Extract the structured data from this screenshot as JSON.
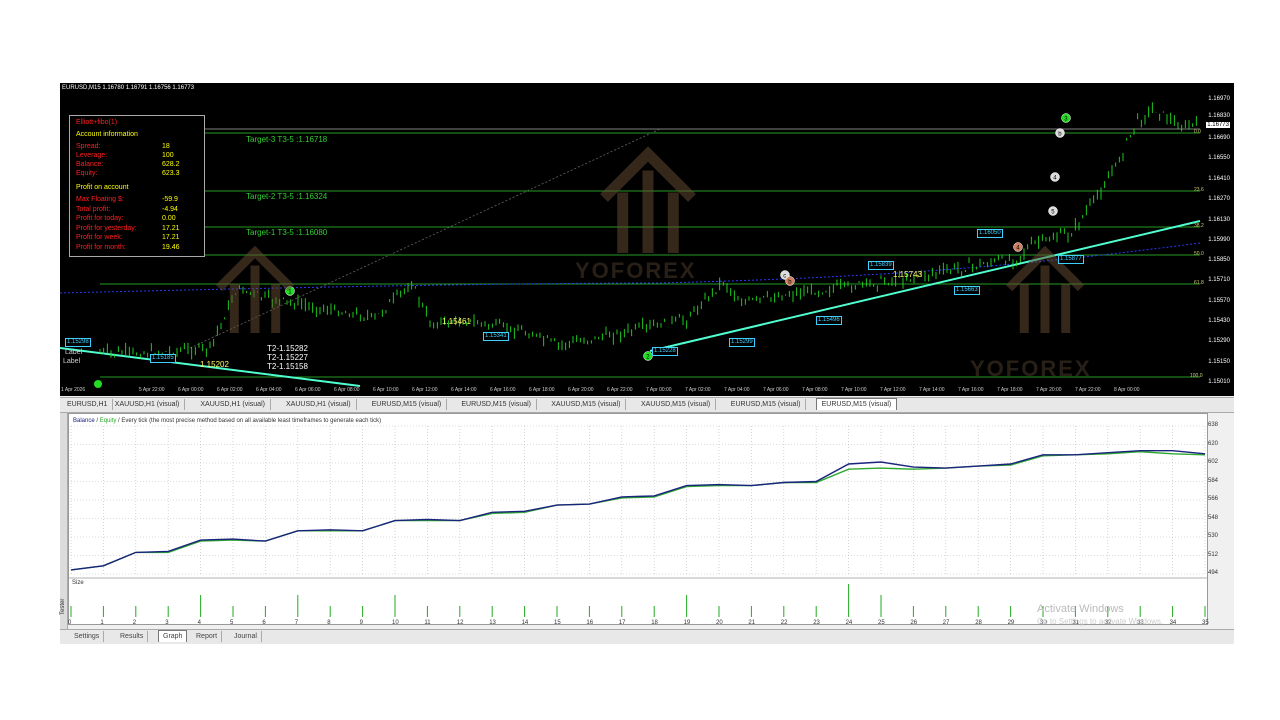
{
  "chart": {
    "symbol_line": "EURUSD,M15  1.16780 1.16791 1.16756 1.16773",
    "price_labels": [
      "1.16970",
      "1.16830",
      "1.16773",
      "1.16690",
      "1.16550",
      "1.16410",
      "1.16270",
      "1.16130",
      "1.15990",
      "1.15850",
      "1.15710",
      "1.15570",
      "1.15430",
      "1.15290",
      "1.15150",
      "1.15010"
    ],
    "fib_labels": [
      "0.0",
      "23.6",
      "38.2",
      "50.0",
      "61.8",
      "100.0"
    ],
    "targets": [
      "Target-3 T3-5 :1.16718",
      "Target-2 T3-5 :1.16324",
      "Target-1 T3-5 :1.16080"
    ],
    "yellow_labels": [
      "1.15461",
      "1.15743",
      "1.15202"
    ],
    "boxes": [
      "1.15298",
      "1.15185",
      "1.15341",
      "1.15228",
      "1.15299",
      "1.15496",
      "1.15663",
      "1.15839",
      "1.16050",
      "1.15877"
    ],
    "t2_labels": [
      "T2-1.15282",
      "T2-1.15227",
      "T2-1.15158"
    ],
    "side_labels": [
      "Label",
      "Label"
    ],
    "time_labels": [
      "1 Apr 2026",
      "5 Apr 22:00",
      "6 Apr 00:00",
      "6 Apr 02:00",
      "6 Apr 04:00",
      "6 Apr 06:00",
      "6 Apr 08:00",
      "6 Apr 10:00",
      "6 Apr 12:00",
      "6 Apr 14:00",
      "6 Apr 16:00",
      "6 Apr 18:00",
      "6 Apr 20:00",
      "6 Apr 22:00",
      "7 Apr 00:00",
      "7 Apr 02:00",
      "7 Apr 04:00",
      "7 Apr 06:00",
      "7 Apr 08:00",
      "7 Apr 10:00",
      "7 Apr 12:00",
      "7 Apr 14:00",
      "7 Apr 16:00",
      "7 Apr 18:00",
      "7 Apr 20:00",
      "7 Apr 22:00",
      "8 Apr 00:00"
    ],
    "watermark": "YOFOREX",
    "wave_markers": [
      "1",
      "2",
      "3",
      "4",
      "5",
      "4",
      "c",
      "b"
    ]
  },
  "info_panel": {
    "title": "Elliott+fibo(1)",
    "account_header": "Account information",
    "rows": [
      {
        "label": "Spread:",
        "value": "18"
      },
      {
        "label": "Leverage:",
        "value": "100"
      },
      {
        "label": "Balance:",
        "value": "628.2"
      },
      {
        "label": "Equity:",
        "value": "623.3"
      }
    ],
    "profit_header": "Profit on account",
    "profit_rows": [
      {
        "label": "Max Floating $:",
        "value": "-59.9"
      },
      {
        "label": "Total profit:",
        "value": "-4.94"
      },
      {
        "label": "Profit for today:",
        "value": "0.00"
      },
      {
        "label": "Profit for yesterday:",
        "value": "17.21"
      },
      {
        "label": "Profit for week:",
        "value": "17.21"
      },
      {
        "label": "Profit for month:",
        "value": "19.46"
      }
    ]
  },
  "chart_tabs": [
    "EURUSD,H1",
    "XAUUSD,H1 (visual)",
    "XAUUSD,H1 (visual)",
    "XAUUSD,H1 (visual)",
    "EURUSD,M15 (visual)",
    "EURUSD,M15 (visual)",
    "XAUUSD,M15 (visual)",
    "XAUUSD,M15 (visual)",
    "EURUSD,M15 (visual)",
    "EURUSD,M15 (visual)"
  ],
  "active_chart_tab": 9,
  "tester": {
    "legend_balance": "Balance",
    "legend_sep": " / ",
    "legend_equity": "Equity",
    "legend_rest": " / Every tick (the most precise method based on all available least timeframes to generate each tick)",
    "size_label": "Size",
    "side_label": "Tester",
    "tabs": [
      "Settings",
      "Results",
      "Graph",
      "Report",
      "Journal"
    ],
    "active_tab": 2,
    "colors": {
      "balance": "#1a237e",
      "equity": "#2ea82e",
      "size": "#22aa22"
    }
  },
  "chart_data": {
    "type": "line",
    "x": [
      0,
      1,
      2,
      3,
      4,
      5,
      6,
      7,
      8,
      9,
      10,
      11,
      12,
      13,
      14,
      15,
      16,
      17,
      18,
      19,
      20,
      21,
      22,
      23,
      24,
      25,
      26,
      27,
      28,
      29,
      30,
      31,
      32,
      33,
      34,
      35
    ],
    "ylim": [
      494,
      638
    ],
    "yticks": [
      494,
      512,
      530,
      548,
      566,
      584,
      602,
      620,
      638
    ],
    "series": [
      {
        "name": "Balance",
        "values": [
          498,
          502,
          515,
          516,
          527,
          528,
          526,
          536,
          537,
          536,
          546,
          547,
          546,
          554,
          555,
          561,
          562,
          569,
          570,
          580,
          581,
          580,
          583,
          584,
          601,
          603,
          598,
          597,
          599,
          601,
          610,
          610,
          612,
          614,
          614,
          611
        ]
      },
      {
        "name": "Equity",
        "values": [
          498,
          502,
          515,
          515,
          526,
          527,
          526,
          536,
          536,
          536,
          546,
          546,
          546,
          553,
          554,
          561,
          562,
          568,
          569,
          579,
          580,
          580,
          583,
          583,
          596,
          597,
          596,
          597,
          599,
          600,
          609,
          610,
          611,
          613,
          611,
          610
        ]
      }
    ],
    "size_values": [
      1,
      1,
      1,
      1,
      2,
      1,
      1,
      2,
      1,
      1,
      2,
      1,
      1,
      1,
      1,
      1,
      1,
      1,
      1,
      2,
      1,
      1,
      1,
      1,
      3,
      2,
      1,
      1,
      1,
      1,
      1,
      1,
      1,
      1,
      1,
      1
    ]
  },
  "watermark_os": {
    "line1": "Activate Windows",
    "line2": "Go to Settings to activate Windows."
  }
}
